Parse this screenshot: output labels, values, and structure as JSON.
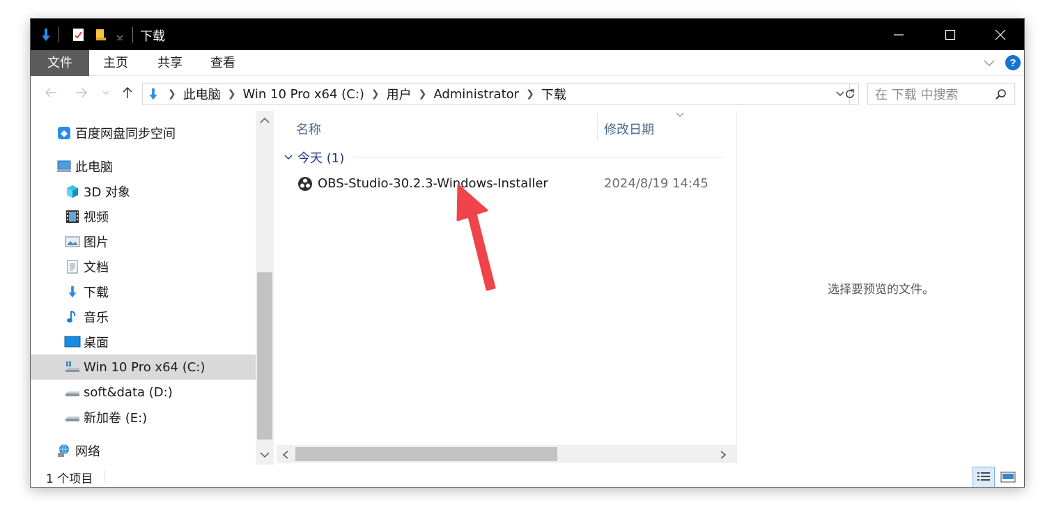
{
  "window": {
    "title": "下载",
    "quick_access": {
      "properties_icon": "properties-icon",
      "newfolder_icon": "folder-icon",
      "customize_icon": "dropdown-icon"
    }
  },
  "ribbon": {
    "tabs": [
      {
        "label": "文件",
        "active": true
      },
      {
        "label": "主页"
      },
      {
        "label": "共享"
      },
      {
        "label": "查看"
      }
    ]
  },
  "address": {
    "crumbs": [
      "此电脑",
      "Win 10 Pro x64 (C:)",
      "用户",
      "Administrator",
      "下载"
    ]
  },
  "search": {
    "placeholder": "在 下载 中搜索"
  },
  "navpane": {
    "items": [
      {
        "label": "百度网盘同步空间",
        "icon": "baidu-netdisk-icon"
      },
      {
        "label": "此电脑",
        "icon": "computer-icon"
      },
      {
        "label": "3D 对象",
        "icon": "cube-icon"
      },
      {
        "label": "视频",
        "icon": "video-icon"
      },
      {
        "label": "图片",
        "icon": "picture-icon"
      },
      {
        "label": "文档",
        "icon": "document-icon"
      },
      {
        "label": "下载",
        "icon": "download-icon"
      },
      {
        "label": "音乐",
        "icon": "music-icon"
      },
      {
        "label": "桌面",
        "icon": "desktop-icon"
      },
      {
        "label": "Win 10 Pro x64 (C:)",
        "icon": "system-drive-icon",
        "selected": true
      },
      {
        "label": "soft&data (D:)",
        "icon": "drive-icon"
      },
      {
        "label": "新加卷 (E:)",
        "icon": "drive-icon"
      },
      {
        "label": "网络",
        "icon": "network-icon"
      }
    ]
  },
  "content": {
    "columns": {
      "name": "名称",
      "modified": "修改日期"
    },
    "group": {
      "label": "今天 (1)"
    },
    "files": [
      {
        "name": "OBS-Studio-30.2.3-Windows-Installer",
        "modified": "2024/8/19 14:45",
        "icon": "obs-icon"
      }
    ]
  },
  "preview": {
    "text": "选择要预览的文件。"
  },
  "status": {
    "count": "1 个项目"
  },
  "colors": {
    "titlebar": "#000000",
    "file_tab": "#5c5c5c",
    "selection": "#d9d9d9",
    "accent": "#0a6cd6",
    "annotation_arrow": "#f0434a"
  }
}
